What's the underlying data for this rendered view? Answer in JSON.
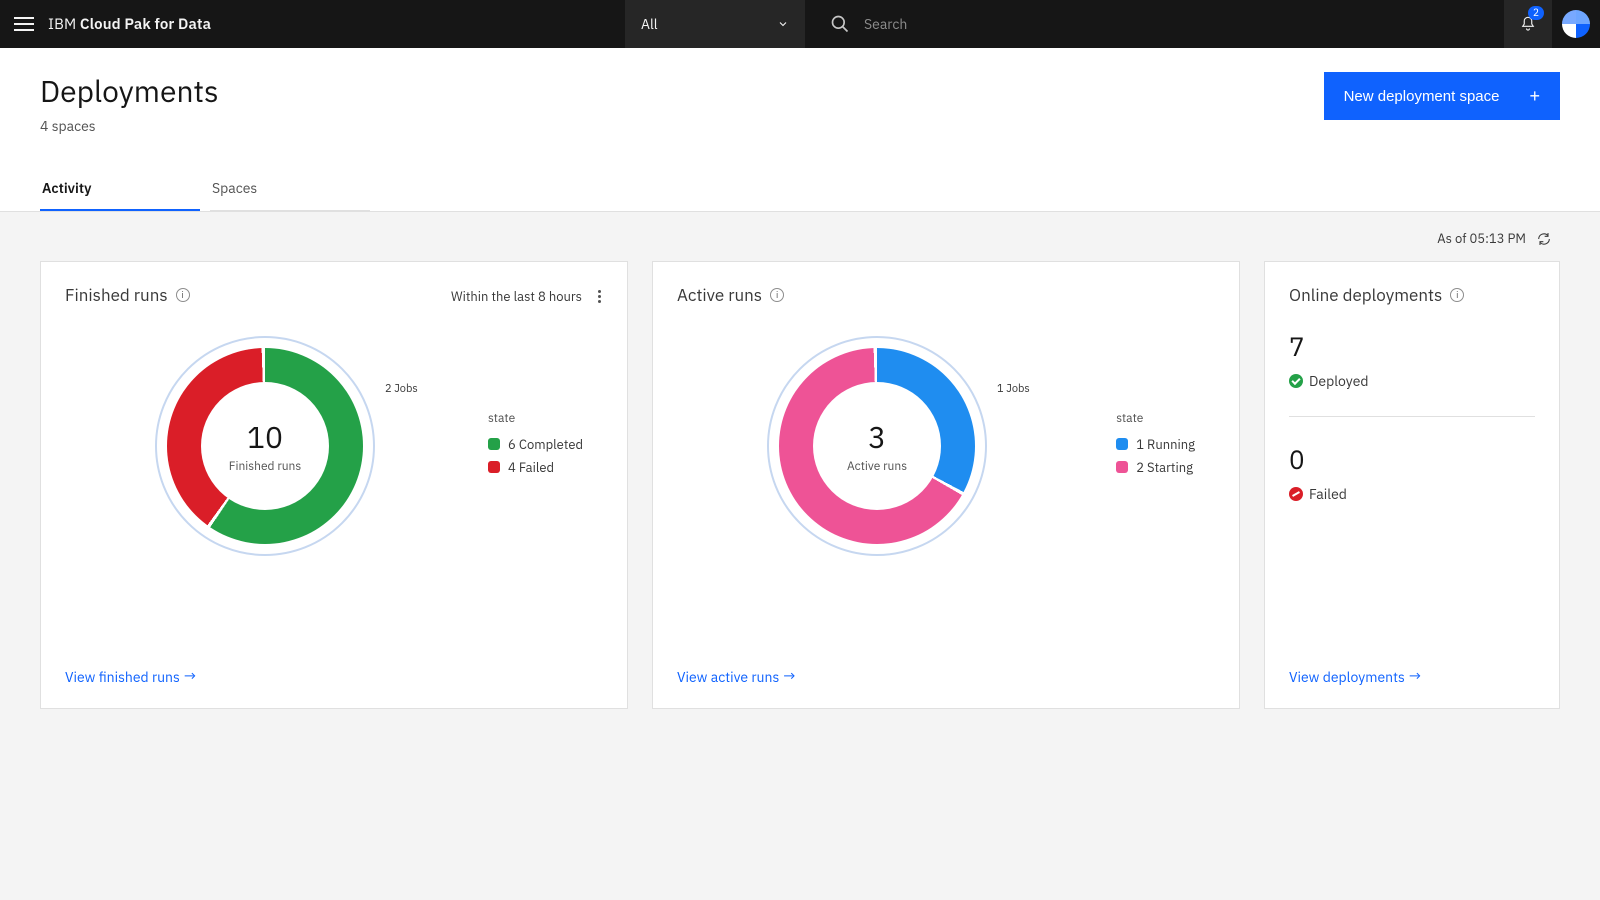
{
  "header": {
    "brand_light": "IBM",
    "brand_bold": "Cloud Pak for Data",
    "scope_label": "All",
    "search_placeholder": "Search",
    "notification_count": "2"
  },
  "page": {
    "title": "Deployments",
    "subtitle": "4 spaces",
    "new_button": "New deployment space"
  },
  "tabs": {
    "activity": "Activity",
    "spaces": "Spaces"
  },
  "asof": "As of 05:13 PM",
  "cards": {
    "finished": {
      "title": "Finished runs",
      "filter": "Within the last 8 hours",
      "center_value": "10",
      "center_label": "Finished runs",
      "callout": "2 Jobs",
      "legend_header": "state",
      "legend_item1": "6 Completed",
      "legend_item2": "4 Failed",
      "link": "View finished runs"
    },
    "active": {
      "title": "Active runs",
      "center_value": "3",
      "center_label": "Active runs",
      "callout": "1 Jobs",
      "legend_header": "state",
      "legend_item1": "1 Running",
      "legend_item2": "2 Starting",
      "link": "View active runs"
    },
    "online": {
      "title": "Online deployments",
      "deployed_value": "7",
      "deployed_label": "Deployed",
      "failed_value": "0",
      "failed_label": "Failed",
      "link": "View deployments"
    }
  },
  "colors": {
    "completed": "#24a148",
    "failed": "#da1e28",
    "running": "#1f8df0",
    "starting": "#ee5396"
  },
  "chart_data": [
    {
      "type": "pie",
      "title": "Finished runs",
      "total": 10,
      "series": [
        {
          "name": "Completed",
          "value": 6,
          "color": "#24a148"
        },
        {
          "name": "Failed",
          "value": 4,
          "color": "#da1e28"
        }
      ],
      "annotation": "2 Jobs"
    },
    {
      "type": "pie",
      "title": "Active runs",
      "total": 3,
      "series": [
        {
          "name": "Running",
          "value": 1,
          "color": "#1f8df0"
        },
        {
          "name": "Starting",
          "value": 2,
          "color": "#ee5396"
        }
      ],
      "annotation": "1 Jobs"
    }
  ]
}
